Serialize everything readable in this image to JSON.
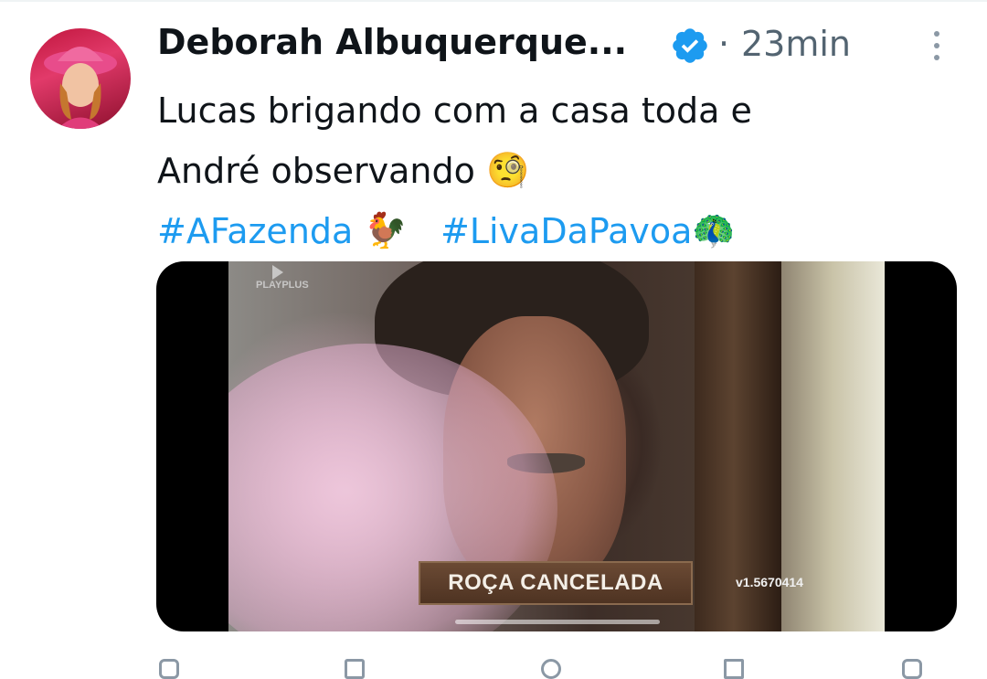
{
  "tweet": {
    "author_name": "Deborah Albuquerque...",
    "timestamp_separator": "·",
    "timestamp": "23min",
    "text_line1": "Lucas brigando com a casa toda e",
    "text_line2": "André observando",
    "emoji_line2": "🧐",
    "hashtag1": "#AFazenda",
    "emoji_hashtag1": "🐓",
    "hashtag2": "#LivaDaPavoa",
    "emoji_hashtag2": "🦚"
  },
  "media": {
    "watermark": "PLAYPLUS",
    "banner_text": "ROÇA CANCELADA",
    "version_text": "v1.5670414"
  },
  "colors": {
    "text": "#0f1419",
    "secondary": "#536471",
    "link": "#1d9bf0",
    "verified": "#1d9bf0"
  },
  "icons": [
    "avatar",
    "verified-badge-icon",
    "more-options-icon",
    "reply-icon",
    "retweet-icon",
    "like-icon",
    "views-icon",
    "share-icon"
  ]
}
